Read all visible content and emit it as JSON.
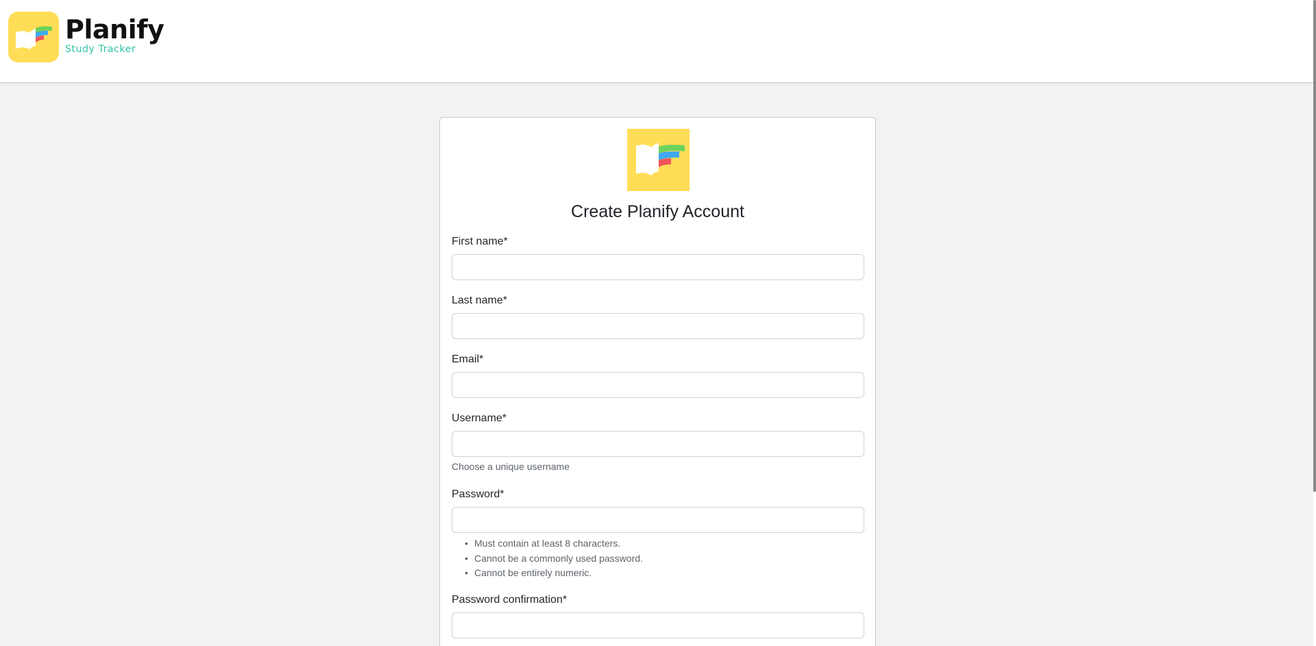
{
  "brand": {
    "name": "Planify",
    "tagline": "Study Tracker",
    "icon": "planify-book-logo-icon"
  },
  "colors": {
    "brand_yellow": "#ffdd57",
    "tagline_teal": "#2ec4a6",
    "stripe_green": "#6dd35c",
    "stripe_blue": "#41a9f0",
    "stripe_red": "#f2545b"
  },
  "form": {
    "title": "Create Planify Account",
    "fields": {
      "first_name": {
        "label": "First name*",
        "value": ""
      },
      "last_name": {
        "label": "Last name*",
        "value": ""
      },
      "email": {
        "label": "Email*",
        "value": ""
      },
      "username": {
        "label": "Username*",
        "value": "",
        "help": "Choose a unique username"
      },
      "password": {
        "label": "Password*",
        "value": "",
        "rules": [
          "Must contain at least 8 characters.",
          "Cannot be a commonly used password.",
          "Cannot be entirely numeric."
        ]
      },
      "password_confirmation": {
        "label": "Password confirmation*",
        "value": ""
      }
    }
  }
}
